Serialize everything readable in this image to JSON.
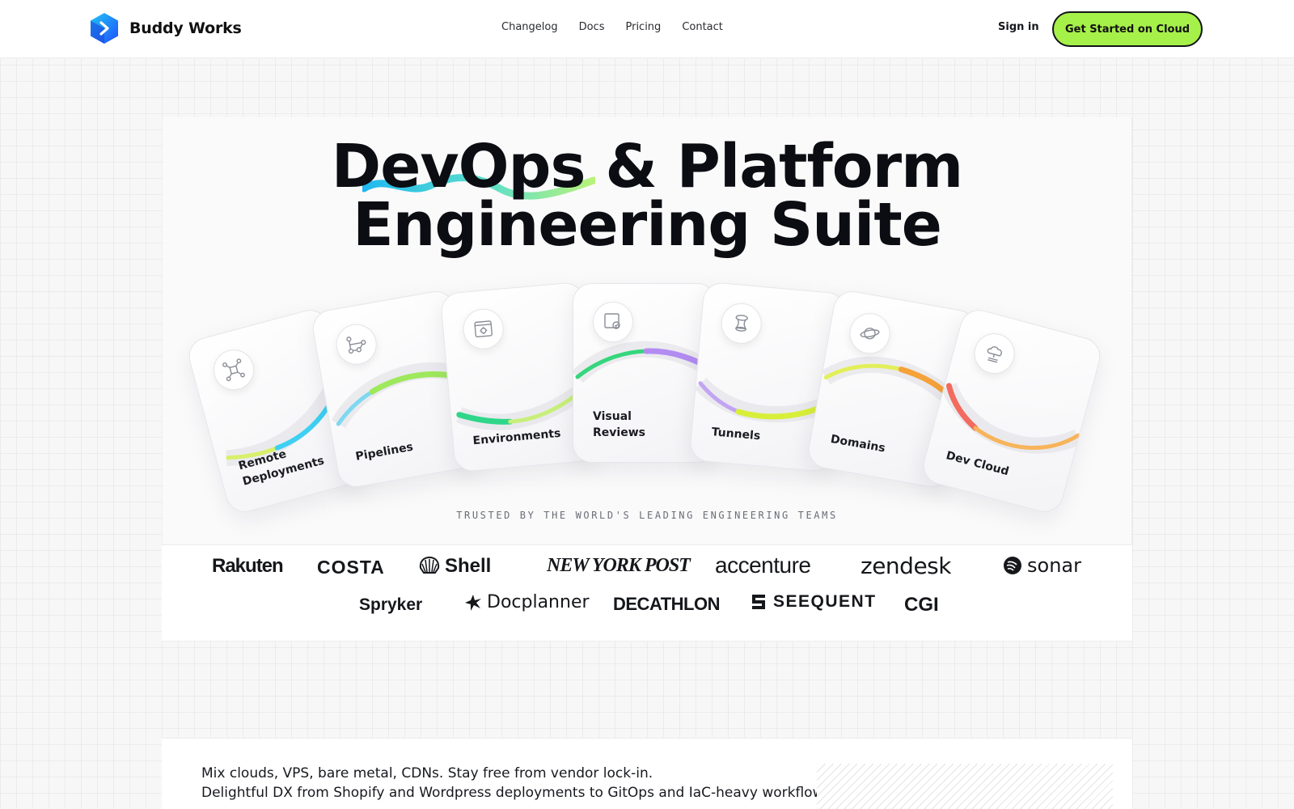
{
  "header": {
    "brand": "Buddy Works",
    "nav": [
      "Changelog",
      "Docs",
      "Pricing",
      "Contact"
    ],
    "signin": "Sign in",
    "cta": "Get Started on Cloud"
  },
  "hero": {
    "headline_line1": "DevOps & Platform",
    "headline_line2": "Engineering Suite"
  },
  "cards": [
    {
      "label_line1": "Remote",
      "label_line2": "Deployments",
      "icon": "network-nodes-icon"
    },
    {
      "label_line1": "Pipelines",
      "label_line2": "",
      "icon": "pipeline-flow-icon"
    },
    {
      "label_line1": "Environments",
      "label_line2": "",
      "icon": "environment-settings-icon"
    },
    {
      "label_line1": "Visual",
      "label_line2": "Reviews",
      "icon": "visual-review-icon"
    },
    {
      "label_line1": "Tunnels",
      "label_line2": "",
      "icon": "tunnel-icon"
    },
    {
      "label_line1": "Domains",
      "label_line2": "",
      "icon": "planet-icon"
    },
    {
      "label_line1": "Dev Cloud",
      "label_line2": "",
      "icon": "cloud-server-icon"
    }
  ],
  "trusted": "TRUSTED BY THE WORLD'S LEADING ENGINEERING TEAMS",
  "logos_row1": [
    "Rakuten",
    "COSTA",
    "Shell",
    "New York Post",
    "accenture",
    "zendesk",
    "sonar"
  ],
  "logos_row2": [
    "Spryker",
    "Docplanner",
    "DECATHLON",
    "SEEQUENT",
    "CGI"
  ],
  "tagline": {
    "line1": "Mix clouds, VPS, bare metal, CDNs. Stay free from vendor lock-in.",
    "line2": "Delightful DX from Shopify and Wordpress deployments to GitOps and IaC-heavy workflows."
  },
  "colors": {
    "cta_bg": "#a6f04a",
    "brand_blue": "#1e6bff",
    "brand_cyan": "#22c6f5"
  }
}
